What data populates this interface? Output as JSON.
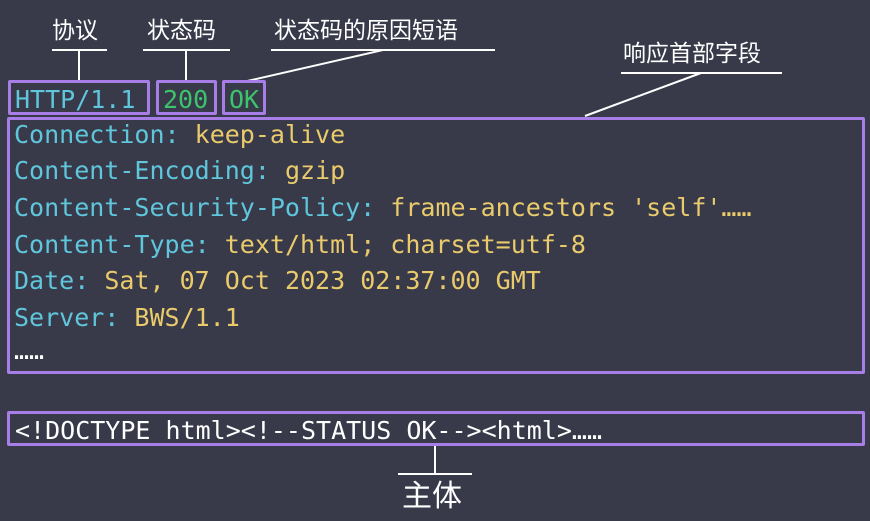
{
  "labels": {
    "protocol": "协议",
    "status_code": "状态码",
    "reason_phrase": "状态码的原因短语",
    "headers": "响应首部字段",
    "body": "主体"
  },
  "status_line": {
    "protocol": "HTTP/1.1",
    "code": "200",
    "reason": "OK"
  },
  "headers": [
    {
      "key": "Connection:",
      "value": "keep-alive"
    },
    {
      "key": "Content-Encoding:",
      "value": "gzip"
    },
    {
      "key": "Content-Security-Policy:",
      "value": "frame-ancestors 'self'……"
    },
    {
      "key": "Content-Type:",
      "value": "text/html; charset=utf-8"
    },
    {
      "key": "Date:",
      "value": "Sat, 07 Oct 2023 02:37:00 GMT"
    },
    {
      "key": "Server:",
      "value": "BWS/1.1"
    }
  ],
  "headers_more": "……",
  "body_text": "<!DOCTYPE html><!--STATUS OK--><html>……",
  "colors": {
    "background": "#383a4a",
    "box_border": "#a77ee8",
    "header_key": "#5fc6dc",
    "header_value": "#eacb6b",
    "status_code": "#3cc46c",
    "protocol": "#5fc6dc"
  }
}
